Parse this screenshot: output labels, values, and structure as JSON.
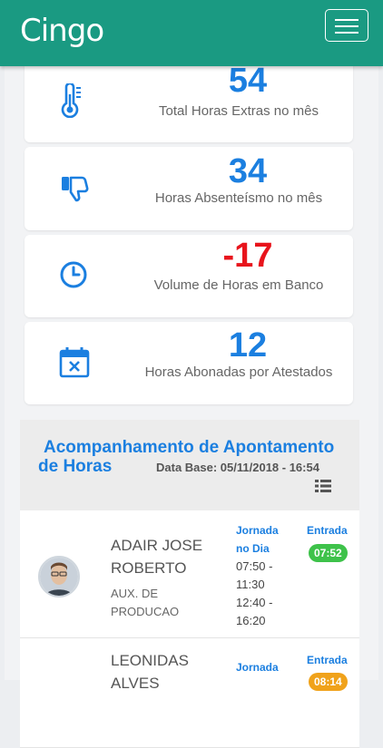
{
  "header": {
    "logo": "Cingo",
    "menu_icon": "hamburger-menu-icon",
    "bg_color": "#1a9a82"
  },
  "stats": [
    {
      "value": "54",
      "label": "Total Horas Extras no mês",
      "icon": "thermometer-icon"
    },
    {
      "value": "34",
      "label": "Horas Absenteísmo no mês",
      "icon": "thumbs-down-icon"
    },
    {
      "value": "-17",
      "label": "Volume de Horas em Banco",
      "icon": "clock-icon"
    },
    {
      "value": "12",
      "label": "Horas Abonadas por Atestados",
      "icon": "calendar-x-icon"
    }
  ],
  "panel": {
    "title": "Acompanhamento de Apontamento de Horas",
    "data_base": "Data Base: 05/11/2018 - 16:54",
    "list_icon": "list-view-icon"
  },
  "employees": [
    {
      "name": "ADAIR JOSE ROBERTO",
      "role": "AUX. DE PRODUCAO",
      "jornada_label": "Jornada no Dia",
      "times": [
        "07:50 -",
        "11:30",
        "12:40 -",
        "16:20"
      ],
      "entrada_label": "Entrada",
      "entrada": "07:52",
      "entrada_color": "#3ec24a"
    },
    {
      "name": "LEONIDAS ALVES",
      "jornada_label": "Jornada",
      "entrada_label": "Entrada",
      "entrada": "08:14",
      "entrada_color": "#f0a21a"
    }
  ],
  "colors": {
    "accent": "#1b7fe0",
    "negative": "#e8141c"
  }
}
